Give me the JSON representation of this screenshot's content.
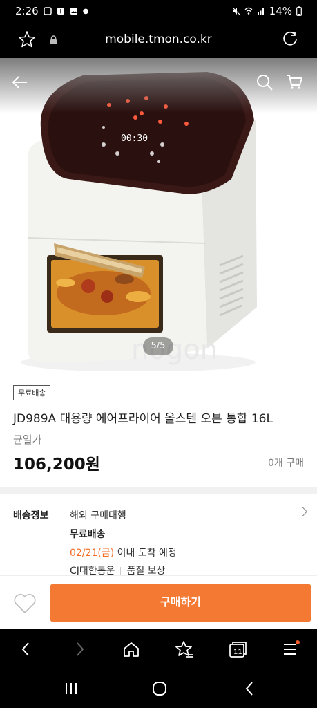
{
  "status_bar": {
    "time": "2:26",
    "battery": "14%"
  },
  "browser": {
    "url": "mobile.tmon.co.kr"
  },
  "gallery": {
    "counter": "5/5",
    "watermark": "nogon"
  },
  "product": {
    "badge": "무료배송",
    "title": "JD989A 대용량 에어프라이어 올스텐 오븐 통합 16L",
    "price_label": "균일가",
    "price": "106,200원",
    "sold": "0개 구매"
  },
  "shipping": {
    "label": "배송정보",
    "line1": "해외 구매대행",
    "line2": "무료배송",
    "date": "02/21(금)",
    "date_suffix": " 이내 도착 예정",
    "carrier": "CJ대한통운",
    "guarantee": "품절 보상"
  },
  "buy": {
    "button": "구매하기"
  },
  "colors": {
    "accent": "#f47a34",
    "orange_text": "#f36b22"
  },
  "icons": [
    "star-icon",
    "lock-icon",
    "reload-icon",
    "back-arrow-icon",
    "search-icon",
    "cart-icon",
    "heart-icon",
    "home-icon",
    "bookmark-icon",
    "tabs-icon",
    "menu-icon"
  ],
  "nav": {
    "tabs_count": "11"
  }
}
